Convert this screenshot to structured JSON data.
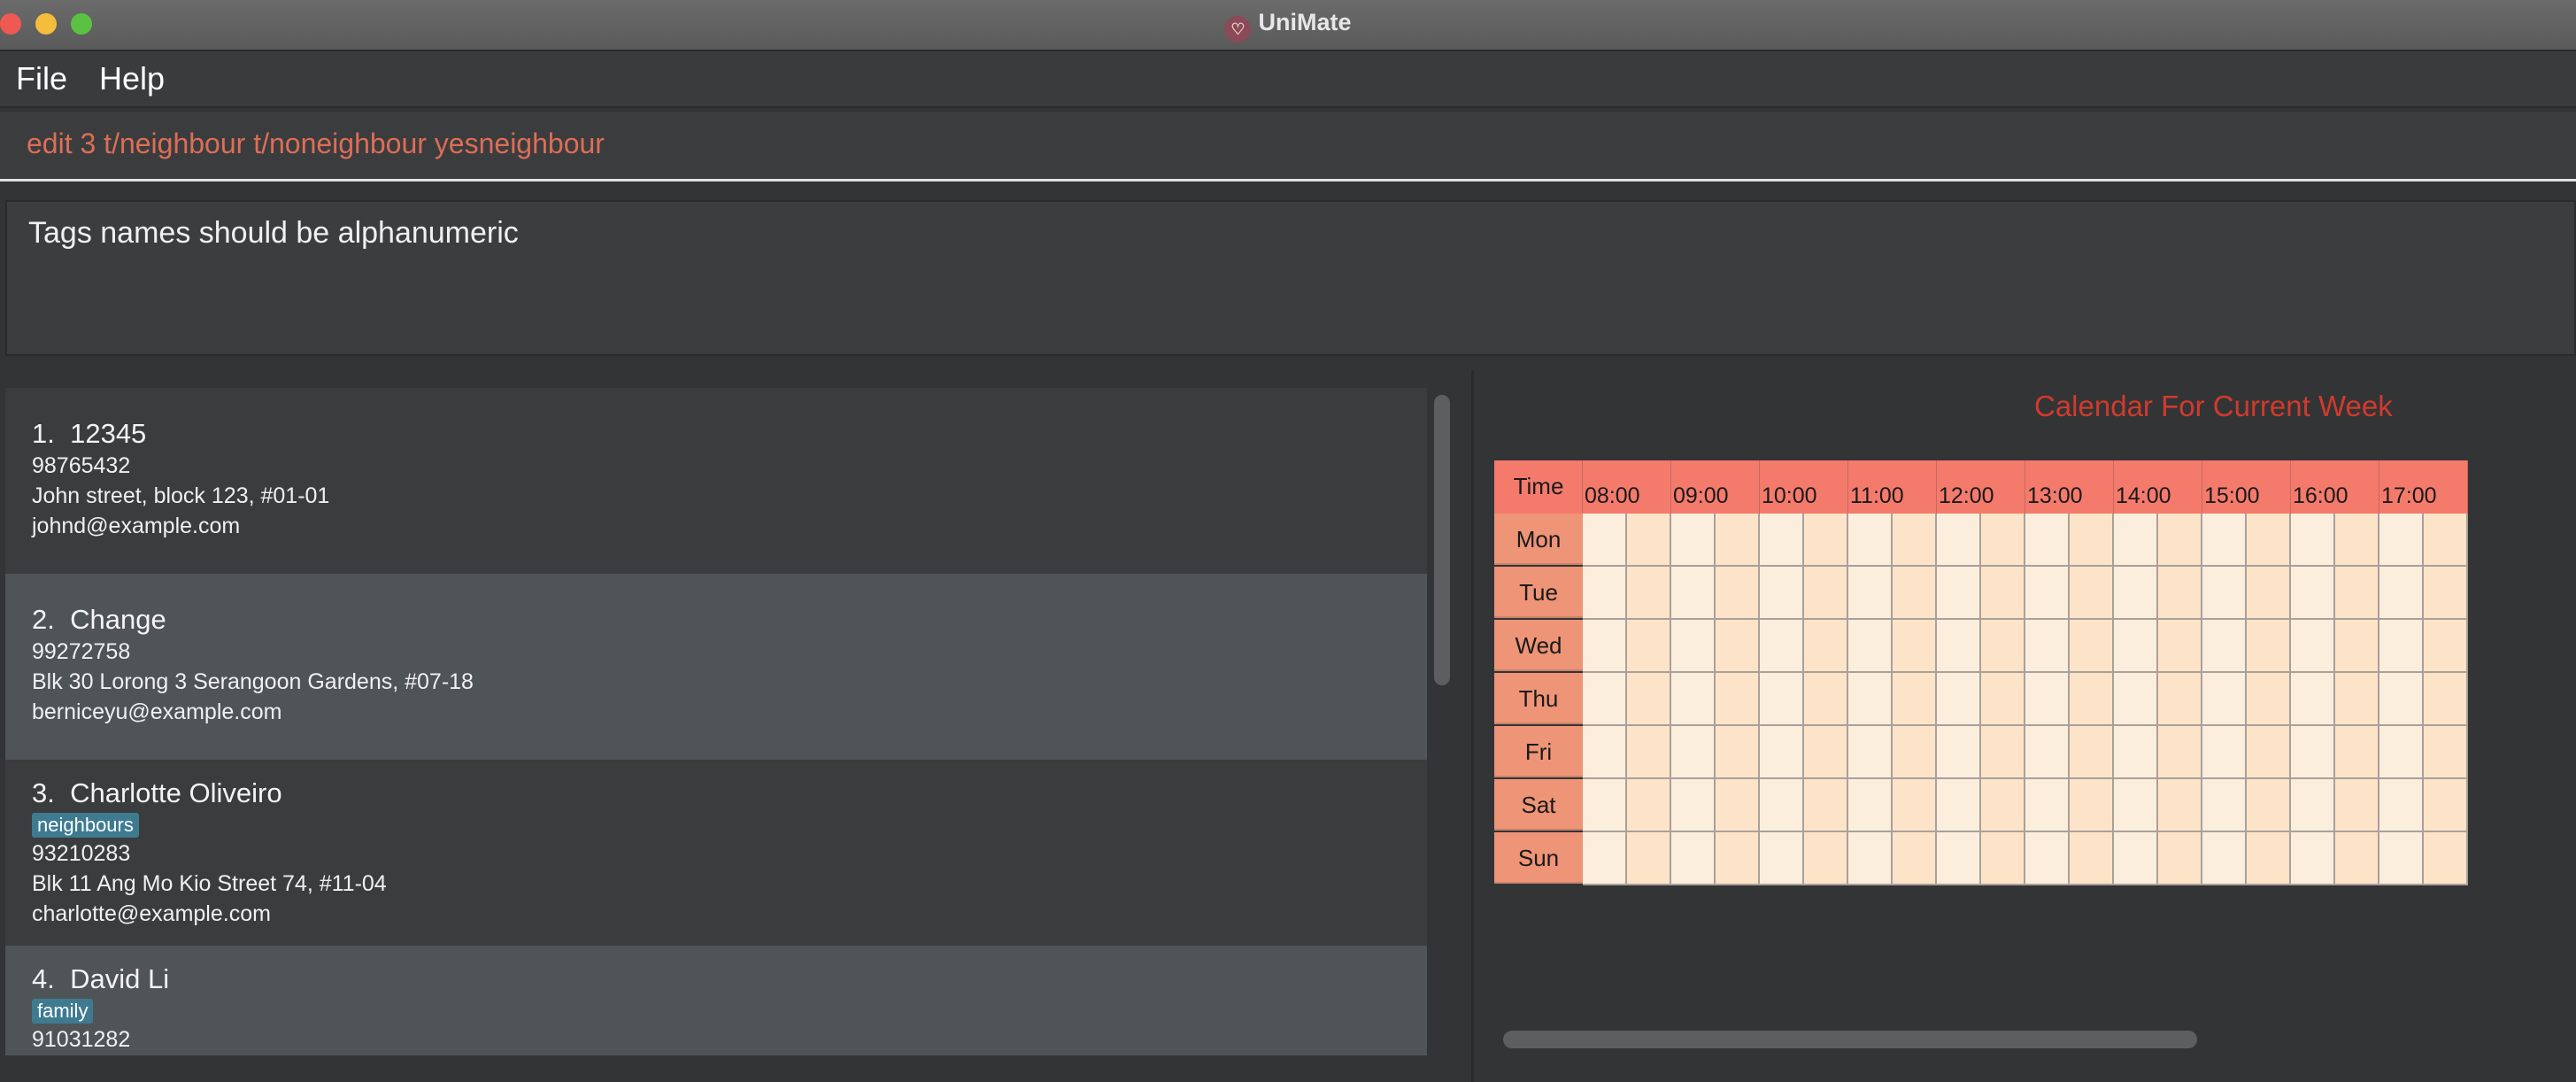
{
  "window": {
    "title": "UniMate"
  },
  "menu": {
    "file": "File",
    "help": "Help"
  },
  "command": {
    "value": "edit 3 t/neighbour t/noneighbour yesneighbour"
  },
  "result": {
    "text": "Tags names should be alphanumeric"
  },
  "persons": [
    {
      "index": "1.",
      "name": "12345",
      "tags": [],
      "phone": "98765432",
      "address": "John street, block 123, #01-01",
      "email": "johnd@example.com"
    },
    {
      "index": "2.",
      "name": "Change",
      "tags": [],
      "phone": "99272758",
      "address": "Blk 30 Lorong 3 Serangoon Gardens, #07-18",
      "email": "berniceyu@example.com"
    },
    {
      "index": "3.",
      "name": "Charlotte Oliveiro",
      "tags": [
        "neighbours"
      ],
      "phone": "93210283",
      "address": "Blk 11 Ang Mo Kio Street 74, #11-04",
      "email": "charlotte@example.com"
    },
    {
      "index": "4.",
      "name": "David Li",
      "tags": [
        "family"
      ],
      "phone": "91031282",
      "address": "",
      "email": ""
    }
  ],
  "calendar": {
    "title": "Calendar For Current Week",
    "time_header": "Time",
    "hours": [
      "08:00",
      "09:00",
      "10:00",
      "11:00",
      "12:00",
      "13:00",
      "14:00",
      "15:00",
      "16:00",
      "17:00"
    ],
    "days": [
      "Mon",
      "Tue",
      "Wed",
      "Thu",
      "Fri",
      "Sat",
      "Sun"
    ]
  },
  "colors": {
    "command_text": "#dc6e56",
    "calendar_title": "#d13a2c",
    "tag_bg": "#3e7b91",
    "header_bg": "#f47a6c",
    "day_bg": "#ee9477"
  }
}
